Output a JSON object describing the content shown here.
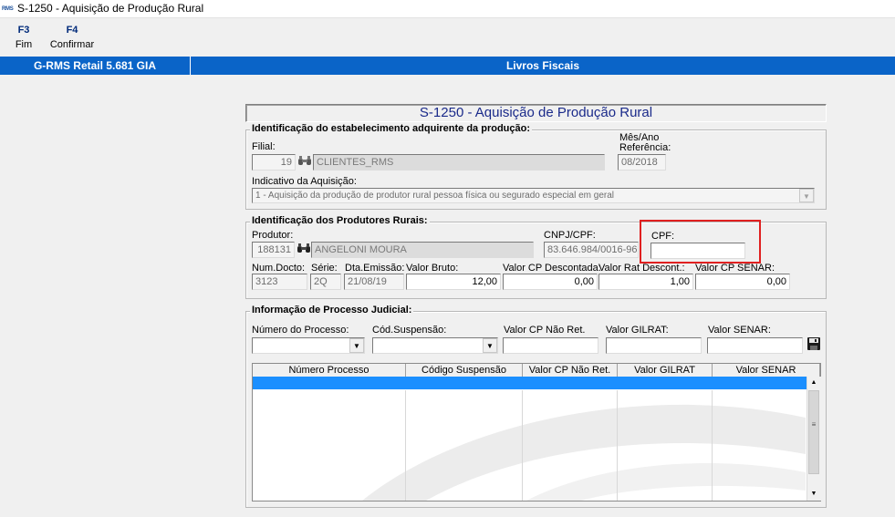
{
  "window": {
    "app_icon": "RMS",
    "title": "S-1250 - Aquisição de Produção Rural"
  },
  "toolbar": {
    "items": [
      {
        "key": "F3",
        "label": "Fim"
      },
      {
        "key": "F4",
        "label": "Confirmar"
      }
    ]
  },
  "band": {
    "left": "G-RMS Retail 5.681 GIA",
    "center": "Livros Fiscais"
  },
  "form": {
    "title": "S-1250 - Aquisição de Produção Rural",
    "estabelecimento": {
      "group_title": "Identificação do estabelecimento adquirente da produção:",
      "filial_label": "Filial:",
      "filial_value": "19",
      "filial_name": "CLIENTES_RMS",
      "ref_label_1": "Mês/Ano",
      "ref_label_2": "Referência:",
      "ref_value": "08/2018",
      "indicativo_label": "Indicativo da Aquisição:",
      "indicativo_value": "1 - Aquisição da produção de produtor rural pessoa física ou segurado especial em geral"
    },
    "produtores": {
      "group_title": "Identificação dos Produtores Rurais:",
      "produtor_label": "Produtor:",
      "produtor_value": "188131",
      "produtor_name": "ANGELONI MOURA",
      "cnpj_label": "CNPJ/CPF:",
      "cnpj_value": "83.646.984/0016-96",
      "cpf_label": "CPF:",
      "cpf_value": "",
      "num_docto_label": "Num.Docto:",
      "num_docto_value": "3123",
      "serie_label": "Série:",
      "serie_value": "2Q",
      "dta_emissao_label": "Dta.Emissão:",
      "dta_emissao_value": "21/08/19",
      "valor_bruto_label": "Valor Bruto:",
      "valor_bruto_value": "12,00",
      "valor_cp_desc_label": "Valor CP Descontada:",
      "valor_cp_desc_value": "0,00",
      "valor_rat_label": "Valor Rat Descont.:",
      "valor_rat_value": "1,00",
      "valor_cp_senar_label": "Valor CP SENAR:",
      "valor_cp_senar_value": "0,00"
    },
    "processo": {
      "group_title": "Informação de Processo Judicial:",
      "numero_label": "Número do Processo:",
      "cod_susp_label": "Cód.Suspensão:",
      "cp_nao_ret_label": "Valor CP Não Ret.",
      "gilrat_label": "Valor GILRAT:",
      "senar_label": "Valor SENAR:",
      "table_headers": [
        "Número Processo",
        "Código Suspensão",
        "Valor CP Não Ret.",
        "Valor GILRAT",
        "Valor SENAR"
      ]
    }
  },
  "icons": {
    "binoculars": "binoculars-icon",
    "save": "floppy-disk-icon",
    "dropdown": "chevron-down-icon"
  },
  "colors": {
    "band": "#0a64c8",
    "selection": "#1b8fff",
    "highlight": "#e02020",
    "title": "#1a2a8a"
  }
}
